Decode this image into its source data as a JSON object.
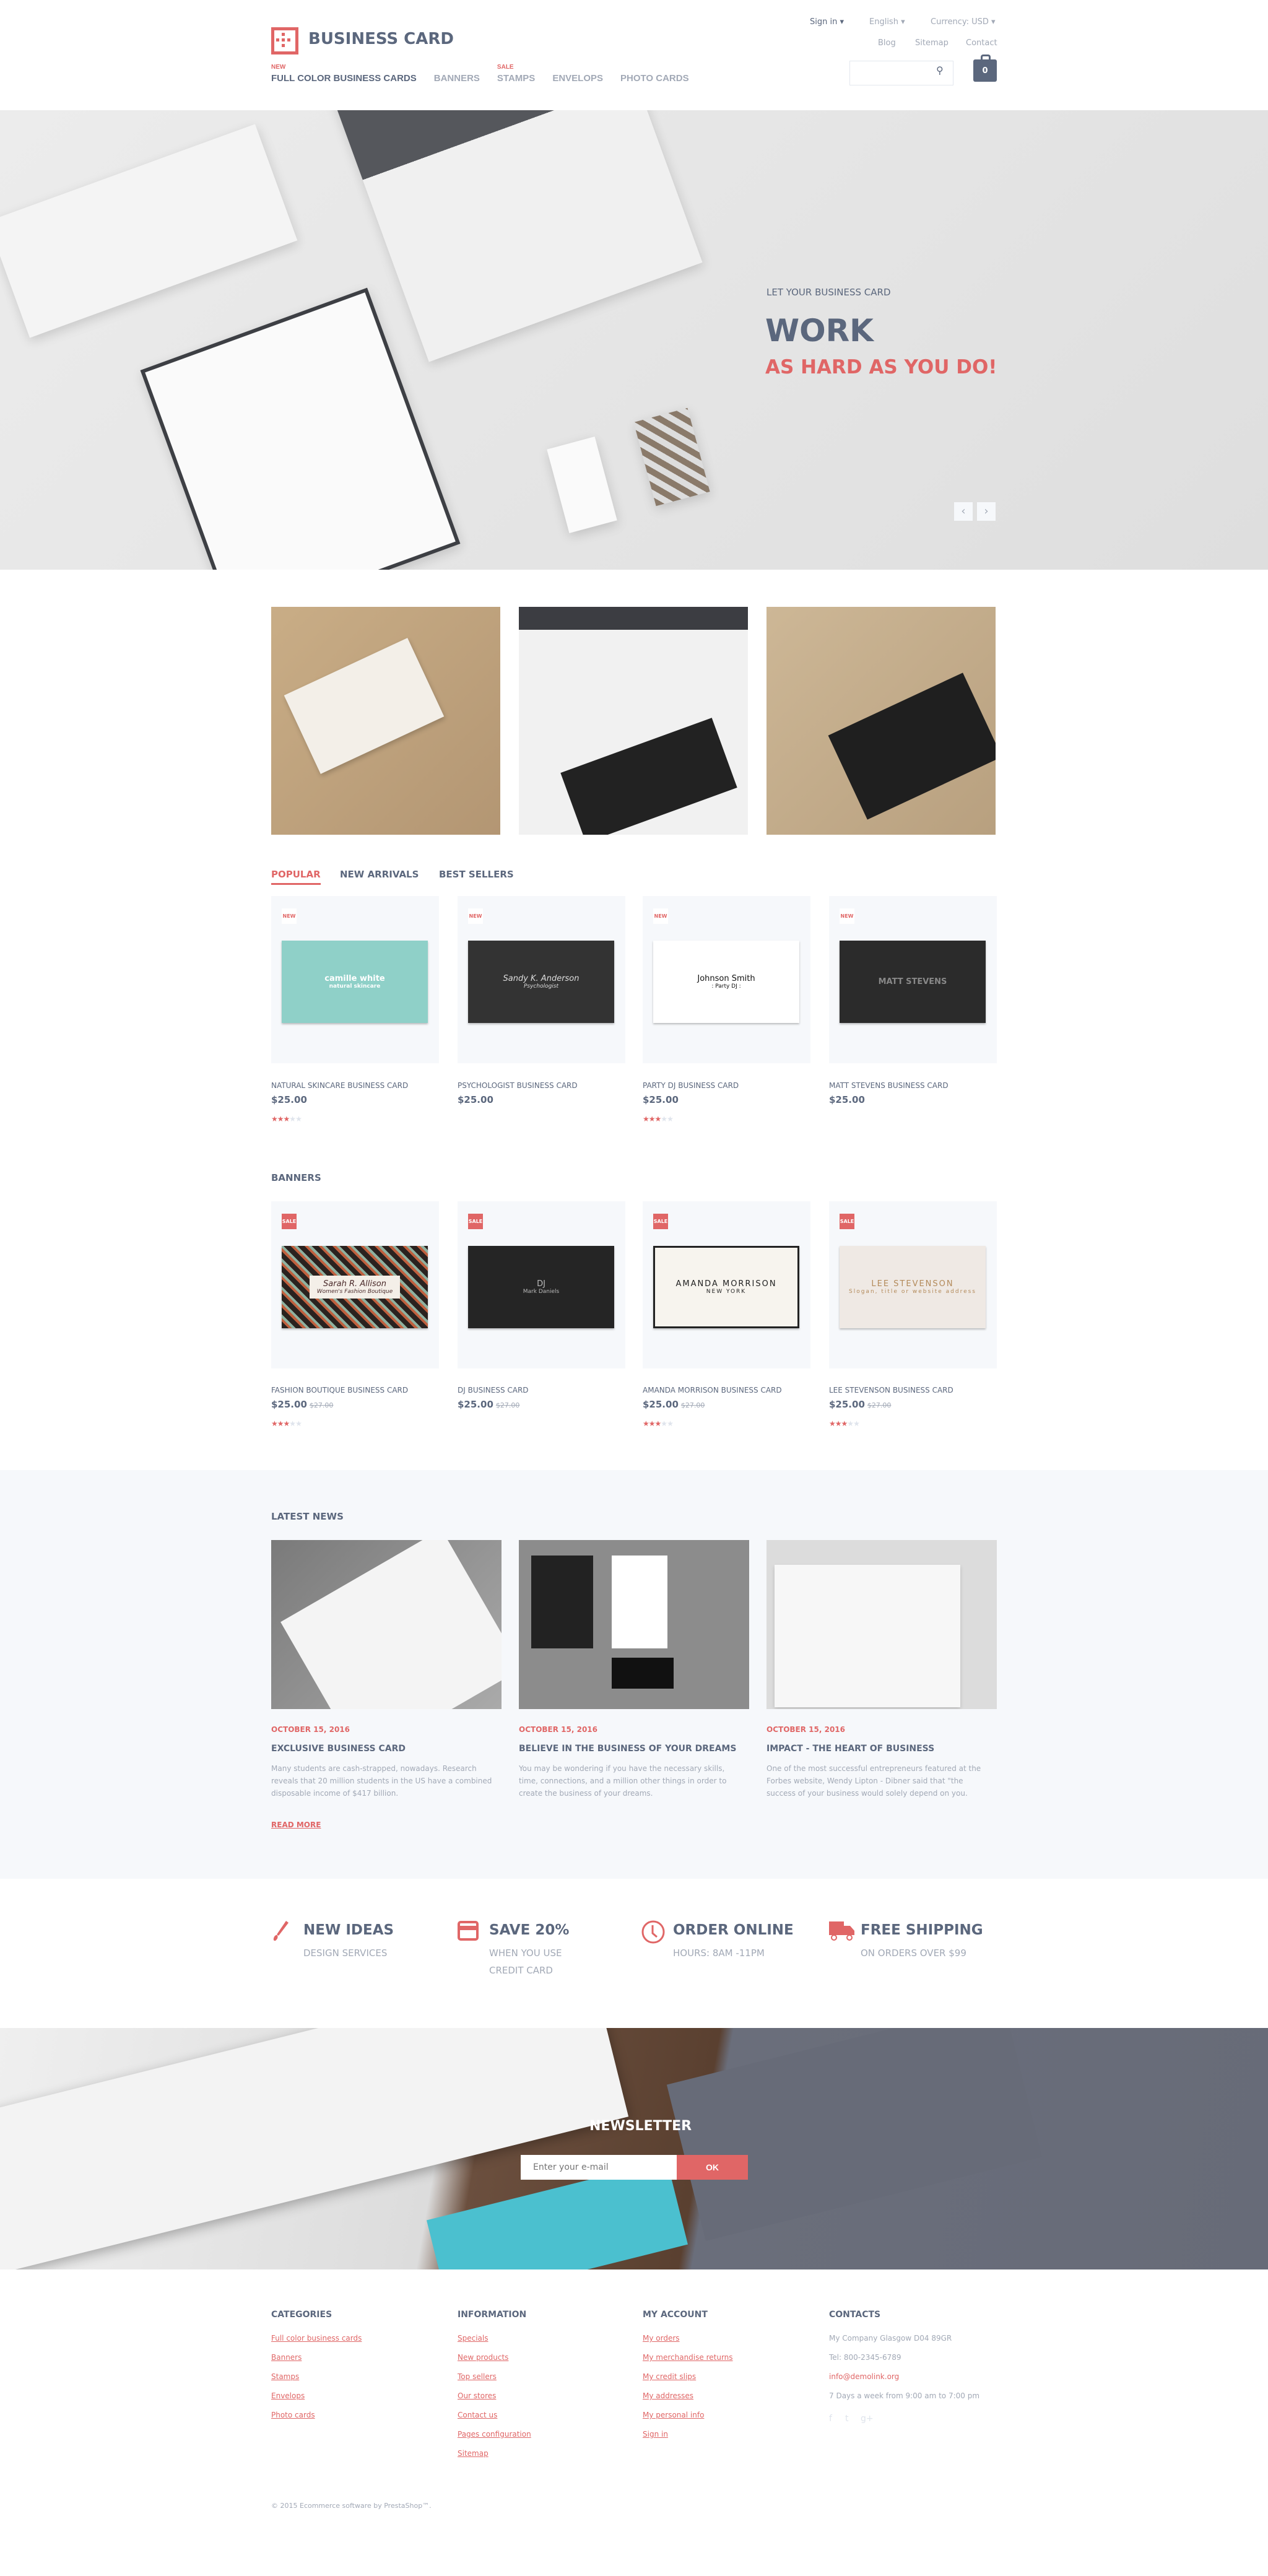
{
  "header": {
    "logo_text": "BUSINESS CARD",
    "top_links": {
      "sign_in": "Sign in ▾",
      "language": "English ▾",
      "currency": "Currency: USD ▾",
      "blog": "Blog",
      "sitemap": "Sitemap",
      "contact": "Contact"
    },
    "nav": [
      {
        "label": "FULL COLOR BUSINESS CARDS",
        "badge": "NEW"
      },
      {
        "label": "BANNERS",
        "badge": ""
      },
      {
        "label": "STAMPS",
        "badge": "SALE"
      },
      {
        "label": "ENVELOPS",
        "badge": ""
      },
      {
        "label": "PHOTO CARDS",
        "badge": ""
      }
    ],
    "search_placeholder": "",
    "cart_count": "0"
  },
  "hero": {
    "subtitle": "LET YOUR BUSINESS CARD",
    "title": "WORK",
    "tagline": "AS HARD AS YOU DO!",
    "prev": "‹",
    "next": "›"
  },
  "tabs": [
    "POPULAR",
    "NEW ARRIVALS",
    "BEST SELLERS"
  ],
  "popular": [
    {
      "badge": "NEW",
      "name": "NATURAL SKINCARE BUSINESS CARD",
      "price": "$25.00",
      "rating": 3,
      "img_text": "camille white",
      "img_sub": "natural skincare"
    },
    {
      "badge": "NEW",
      "name": "PSYCHOLOGIST BUSINESS CARD",
      "price": "$25.00",
      "rating": 0,
      "img_text": "Sandy K. Anderson",
      "img_sub": "Psychologist"
    },
    {
      "badge": "NEW",
      "name": "PARTY DJ BUSINESS CARD",
      "price": "$25.00",
      "rating": 3,
      "img_text": "Johnson Smith",
      "img_sub": ": Party DJ :"
    },
    {
      "badge": "NEW",
      "name": "MATT STEVENS BUSINESS CARD",
      "price": "$25.00",
      "rating": 0,
      "img_text": "MATT STEVENS",
      "img_sub": ""
    }
  ],
  "banners": {
    "heading": "BANNERS",
    "items": [
      {
        "badge": "SALE",
        "name": "FASHION BOUTIQUE BUSINESS CARD",
        "price": "$25.00",
        "old_price": "$27.00",
        "rating": 3,
        "img_text": "Sarah R. Allison",
        "img_sub": "Women's Fashion Boutique"
      },
      {
        "badge": "SALE",
        "name": "DJ BUSINESS CARD",
        "price": "$25.00",
        "old_price": "$27.00",
        "rating": 0,
        "img_text": "DJ",
        "img_sub": "Mark Daniels"
      },
      {
        "badge": "SALE",
        "name": "AMANDA MORRISON BUSINESS CARD",
        "price": "$25.00",
        "old_price": "$27.00",
        "rating": 3,
        "img_text": "AMANDA MORRISON",
        "img_sub": "NEW YORK"
      },
      {
        "badge": "SALE",
        "name": "LEE STEVENSON BUSINESS CARD",
        "price": "$25.00",
        "old_price": "$27.00",
        "rating": 3,
        "img_text": "LEE STEVENSON",
        "img_sub": "Slogan, title or website address"
      }
    ]
  },
  "news": {
    "heading": "LATEST NEWS",
    "items": [
      {
        "date": "OCTOBER 15, 2016",
        "title": "EXCLUSIVE BUSINESS CARD",
        "text": "Many students are cash-strapped, nowadays. Research reveals that 20 million students in the US have a combined disposable income of $417 billion."
      },
      {
        "date": "OCTOBER 15, 2016",
        "title": "BELIEVE IN THE BUSINESS OF YOUR DREAMS",
        "text": "You may be wondering if you have the necessary skills, time, connections, and a million other things in order to create the business of your dreams."
      },
      {
        "date": "OCTOBER 15, 2016",
        "title": "IMPACT - THE HEART OF BUSINESS",
        "text": "One of the most successful entrepreneurs featured at the Forbes website, Wendy Lipton - Dibner said that \"the success of your business would solely depend on you."
      }
    ],
    "read_more": "READ MORE"
  },
  "features": [
    {
      "icon": "brush-icon",
      "title": "NEW IDEAS",
      "sub": "DESIGN SERVICES"
    },
    {
      "icon": "credit-card-icon",
      "title": "SAVE 20%",
      "sub": "WHEN YOU USE CREDIT CARD"
    },
    {
      "icon": "clock-icon",
      "title": "ORDER ONLINE",
      "sub": "HOURS: 8AM -11PM"
    },
    {
      "icon": "truck-icon",
      "title": "FREE SHIPPING",
      "sub": "ON ORDERS OVER $99"
    }
  ],
  "newsletter": {
    "title": "NEWSLETTER",
    "placeholder": "Enter your e-mail",
    "button": "OK"
  },
  "footer": {
    "categories": {
      "heading": "CATEGORIES",
      "links": [
        "Full color business cards",
        "Banners",
        "Stamps",
        "Envelops",
        "Photo cards"
      ]
    },
    "information": {
      "heading": "INFORMATION",
      "links": [
        "Specials",
        "New products",
        "Top sellers",
        "Our stores",
        "Contact us",
        "Pages configuration",
        "Sitemap"
      ]
    },
    "account": {
      "heading": "MY ACCOUNT",
      "links": [
        "My orders",
        "My merchandise returns",
        "My credit slips",
        "My addresses",
        "My personal info",
        "Sign in"
      ]
    },
    "contacts": {
      "heading": "CONTACTS",
      "address": "My Company Glasgow D04 89GR",
      "tel": "Tel: 800-2345-6789",
      "email": "info@demolink.org",
      "hours": "7 Days a week from 9:00 am to 7:00 pm",
      "social": [
        "f",
        "t",
        "g+"
      ]
    },
    "copyright": "© 2015 Ecommerce software by PrestaShop™."
  },
  "colors": {
    "accent": "#e06666",
    "text": "#5b677d",
    "muted": "#a2a9b6",
    "panel": "#f6f8fb"
  }
}
